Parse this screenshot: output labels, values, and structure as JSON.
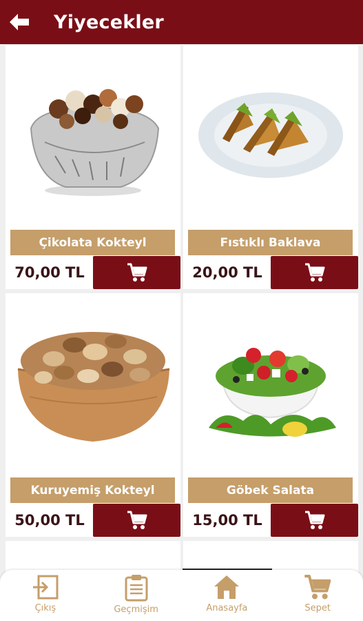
{
  "appbar": {
    "title": "Yiyecekler",
    "back_icon": "arrow-left-icon"
  },
  "products": [
    {
      "name": "Çikolata Kokteyl",
      "price": "70,00 TL",
      "image": "chocolate-bowl"
    },
    {
      "name": "Fıstıklı Baklava",
      "price": "20,00 TL",
      "image": "baklava-plate"
    },
    {
      "name": "Kuruyemiş Kokteyl",
      "price": "50,00 TL",
      "image": "nut-bowl"
    },
    {
      "name": "Göbek Salata",
      "price": "15,00 TL",
      "image": "salad-bowl"
    }
  ],
  "cart_icon": "cart-icon",
  "bottom_nav": [
    {
      "label": "Çıkış",
      "icon": "exit-icon"
    },
    {
      "label": "Geçmişim",
      "icon": "clipboard-icon"
    },
    {
      "label": "Anasayfa",
      "icon": "home-icon"
    },
    {
      "label": "Sepet",
      "icon": "cart-icon"
    }
  ],
  "colors": {
    "primary": "#7a0e16",
    "gold": "#c59e6a",
    "background": "#efefef"
  }
}
